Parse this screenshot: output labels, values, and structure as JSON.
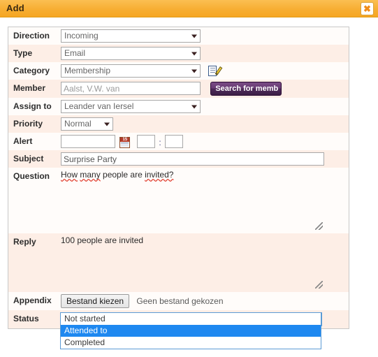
{
  "window": {
    "title": "Add",
    "close_label": "✖",
    "close_icon": "close-x-icon"
  },
  "form": {
    "rows": [
      {
        "label": "Direction",
        "type": "select",
        "value": "Incoming"
      },
      {
        "label": "Type",
        "type": "select",
        "value": "Email"
      },
      {
        "label": "Category",
        "type": "select",
        "value": "Membership",
        "icon": "edit-document-icon"
      },
      {
        "label": "Member",
        "type": "text",
        "value": "Aalst, V.W. van"
      },
      {
        "label": "Assign to",
        "type": "select",
        "value": "Leander van Iersel"
      },
      {
        "label": "Priority",
        "type": "select",
        "value": "Normal"
      },
      {
        "label": "Alert",
        "type": "datetime",
        "date": "",
        "hour": "",
        "minute": "",
        "separator": ":",
        "icon": "calendar-icon",
        "icon_day": "15"
      },
      {
        "label": "Subject",
        "type": "text",
        "value": "Surprise Party"
      },
      {
        "label": "Question",
        "type": "textarea",
        "value": "How many people are invited?"
      },
      {
        "label": "Reply",
        "type": "textarea",
        "value": "100 people are invited"
      },
      {
        "label": "Appendix",
        "type": "file"
      },
      {
        "label": "Status",
        "type": "select-open",
        "value": "Not started"
      }
    ],
    "search_member_button": "Search for memb",
    "file_button": "Bestand kiezen",
    "file_status": "Geen bestand gekozen"
  },
  "question_text": {
    "word1": "How",
    "word2": "many",
    "mid": " people are ",
    "word3": "invited?"
  },
  "status_dropdown": {
    "options": [
      "Not started",
      "Attended to",
      "Completed"
    ],
    "selected_index": 1
  },
  "colors": {
    "titlebar": "#f5a623",
    "row_stripe": "#fdeee6",
    "highlight": "#1e88f0",
    "button_purple": "#4e2a59",
    "focus_border": "#5b9bd5"
  }
}
